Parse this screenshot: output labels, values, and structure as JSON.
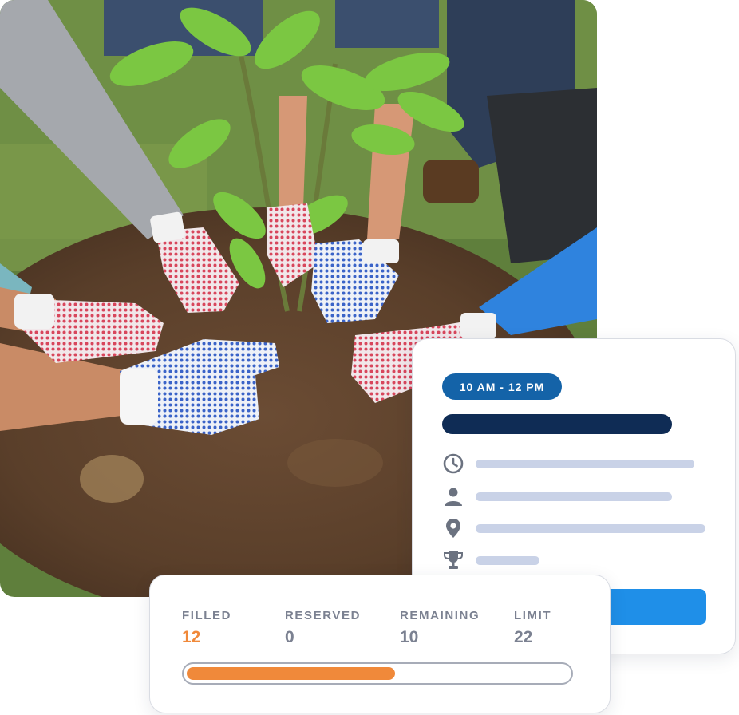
{
  "photo": {
    "subject": "volunteers-planting-tree-photo"
  },
  "event_card": {
    "time_label": "10 AM - 12 PM",
    "details": [
      {
        "icon": "clock-icon"
      },
      {
        "icon": "person-icon"
      },
      {
        "icon": "location-pin-icon"
      },
      {
        "icon": "trophy-icon"
      }
    ],
    "colors": {
      "pill": "#1463a8",
      "title_placeholder": "#0f2c55",
      "line_placeholder": "#c9d2e7",
      "button": "#1f8fe8"
    }
  },
  "capacity": {
    "filled_label": "FILLED",
    "filled_value": "12",
    "reserved_label": "RESERVED",
    "reserved_value": "0",
    "remaining_label": "REMAINING",
    "remaining_value": "10",
    "limit_label": "LIMIT",
    "limit_value": "22",
    "progress_fraction": 0.545,
    "colors": {
      "filled": "#f0893a",
      "label": "#7b8191"
    }
  }
}
